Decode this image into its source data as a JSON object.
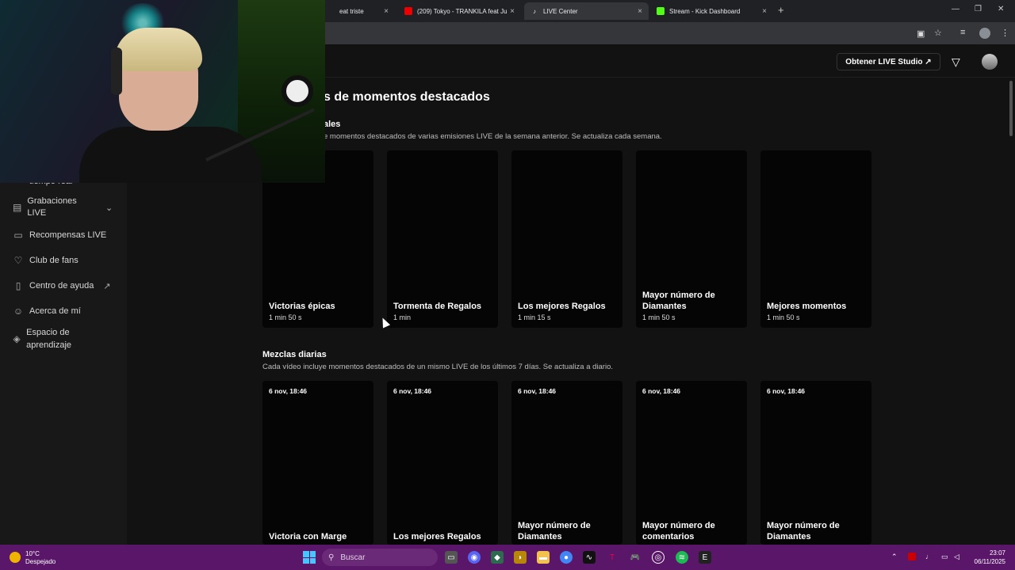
{
  "browser": {
    "tabs": [
      {
        "title": "eat triste",
        "icon": "music-icon",
        "active": false
      },
      {
        "title": "(209) Tokyo - TRANKILA feat Ju",
        "icon": "youtube-icon",
        "active": false
      },
      {
        "title": "LIVE Center",
        "icon": "tiktok-icon",
        "active": true
      },
      {
        "title": "Stream - Kick Dashboard",
        "icon": "kick-icon",
        "active": false
      }
    ],
    "new_tab": "+",
    "close_glyph": "×"
  },
  "header": {
    "studio_button": "Obtener LIVE Studio ↗"
  },
  "sidebar": {
    "items": [
      {
        "label": "tiempo real",
        "icon": "clock-icon",
        "external": false
      },
      {
        "label": "Grabaciones LIVE",
        "icon": "recordings-icon",
        "external": false
      },
      {
        "label": "Recompensas LIVE",
        "icon": "rewards-icon",
        "external": false
      },
      {
        "label": "Club de fans",
        "icon": "heart-icon",
        "external": false
      },
      {
        "label": "Centro de ayuda",
        "icon": "book-icon",
        "external": true
      },
      {
        "label": "Acerca de mí",
        "icon": "user-icon",
        "external": false
      },
      {
        "label": "Espacio de aprendizaje",
        "icon": "learning-icon",
        "external": false
      }
    ],
    "external_glyph": "↗",
    "chevron_glyph": "⌄"
  },
  "main": {
    "title": "s de momentos destacados",
    "weekly": {
      "heading": "ales",
      "description": "e momentos destacados de varias emisiones LIVE de la semana anterior. Se actualiza cada semana.",
      "cards": [
        {
          "title": "Victorias épicas",
          "duration": "1 min 50 s"
        },
        {
          "title": "Tormenta de Regalos",
          "duration": "1 min"
        },
        {
          "title": "Los mejores Regalos",
          "duration": "1 min 15 s"
        },
        {
          "title": "Mayor número de Diamantes",
          "duration": "1 min 50 s"
        },
        {
          "title": "Mejores momentos",
          "duration": "1 min 50 s"
        }
      ]
    },
    "daily": {
      "heading": "Mezclas diarias",
      "description": "Cada vídeo incluye momentos destacados de un mismo LIVE de los últimos 7 días. Se actualiza a diario.",
      "cards": [
        {
          "date": "6 nov, 18:46",
          "title": "Victoria con Marge"
        },
        {
          "date": "6 nov, 18:46",
          "title": "Los mejores Regalos"
        },
        {
          "date": "6 nov, 18:46",
          "title": "Mayor número de Diamantes"
        },
        {
          "date": "6 nov, 18:46",
          "title": "Mayor número de comentarios"
        },
        {
          "date": "6 nov, 18:46",
          "title": "Mayor número de Diamantes"
        }
      ]
    }
  },
  "taskbar": {
    "weather_temp": "10°C",
    "weather_desc": "Despejado",
    "search_placeholder": "Buscar",
    "time": "23:07",
    "date": "06/11/2025"
  },
  "colors": {
    "background": "#121212",
    "sidebar": "#181818",
    "card": "#050505",
    "taskbar": "#5a1668"
  }
}
